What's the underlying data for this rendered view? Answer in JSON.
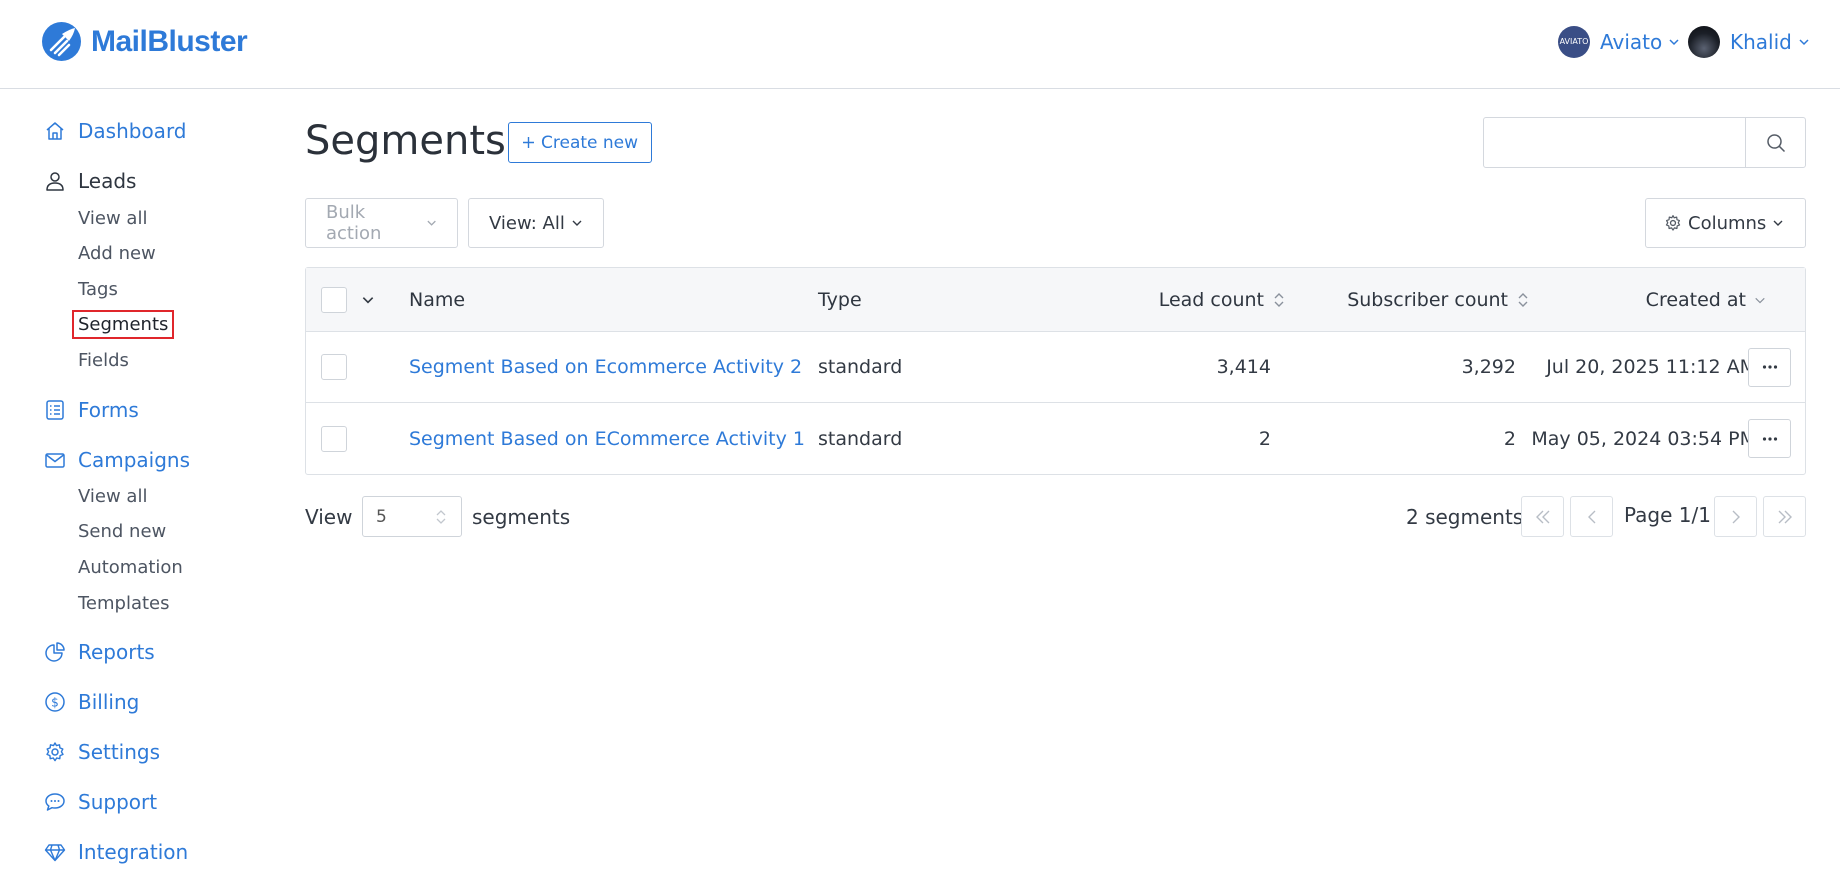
{
  "brand": {
    "name": "MailBluster",
    "color": "#2e7ad8"
  },
  "header": {
    "org": {
      "name": "Aviato",
      "avatar_text": "AVIATO"
    },
    "user": {
      "name": "Khalid"
    }
  },
  "sidebar": {
    "dashboard": "Dashboard",
    "leads": {
      "label": "Leads",
      "items": [
        "View all",
        "Add new",
        "Tags",
        "Segments",
        "Fields"
      ],
      "active": "Segments"
    },
    "forms": "Forms",
    "campaigns": {
      "label": "Campaigns",
      "items": [
        "View all",
        "Send new",
        "Automation",
        "Templates"
      ]
    },
    "reports": "Reports",
    "billing": "Billing",
    "settings": "Settings",
    "support": "Support",
    "integration": "Integration"
  },
  "main": {
    "title": "Segments",
    "create_label": "Create new",
    "search_placeholder": "",
    "bulk_action_label": "Bulk action",
    "view_label": "View: All",
    "columns_label": "Columns"
  },
  "table": {
    "headers": {
      "name": "Name",
      "type": "Type",
      "lead_count": "Lead count",
      "subscriber_count": "Subscriber count",
      "created_at": "Created at"
    },
    "rows": [
      {
        "name": "Segment Based on Ecommerce Activity 2",
        "type": "standard",
        "lead_count": "3,414",
        "subscriber_count": "3,292",
        "created_at": "Jul 20, 2025 11:12 AM"
      },
      {
        "name": "Segment Based on ECommerce Activity 1",
        "type": "standard",
        "lead_count": "2",
        "subscriber_count": "2",
        "created_at": "May 05, 2024 03:54 PM"
      }
    ]
  },
  "footer": {
    "view_label": "View",
    "page_size": "5",
    "unit_label": "segments",
    "total_label": "2 segments",
    "page_label": "Page 1/1"
  },
  "colors": {
    "accent": "#2e7ad8",
    "highlight_outline": "#e0262b"
  }
}
